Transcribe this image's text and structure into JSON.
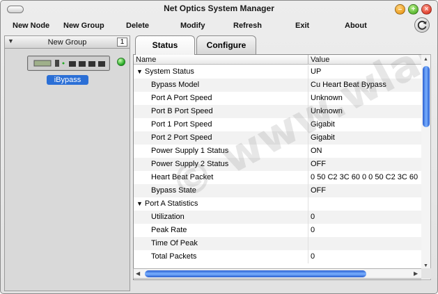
{
  "window": {
    "title": "Net Optics System Manager"
  },
  "menu": {
    "items": [
      "New Node",
      "New Group",
      "Delete",
      "Modify",
      "Refresh",
      "Exit",
      "About"
    ]
  },
  "icons": {
    "pill": "toolbar-toggle-icon",
    "minimize": "minimize-icon",
    "maximize": "maximize-icon",
    "close": "close-icon",
    "refresh": "refresh-icon",
    "device": "network-device-icon",
    "status": "status-ok-icon"
  },
  "sidebar": {
    "group_name": "New Group",
    "group_count": "1",
    "device_label": "iBypass"
  },
  "tabs": [
    "Status",
    "Configure"
  ],
  "table": {
    "headers": [
      "Name",
      "Value"
    ],
    "rows": [
      {
        "name": "System Status",
        "value": "UP",
        "section": true
      },
      {
        "name": "Bypass Model",
        "value": "Cu Heart Beat Bypass"
      },
      {
        "name": "Port A Port Speed",
        "value": "Unknown"
      },
      {
        "name": "Port B Port Speed",
        "value": "Unknown"
      },
      {
        "name": "Port 1 Port Speed",
        "value": "Gigabit"
      },
      {
        "name": "Port 2 Port Speed",
        "value": "Gigabit"
      },
      {
        "name": "Power Supply 1 Status",
        "value": "ON"
      },
      {
        "name": "Power Supply 2 Status",
        "value": "OFF"
      },
      {
        "name": "Heart Beat Packet",
        "value": "0 50 C2 3C 60 0 0 50 C2 3C 60"
      },
      {
        "name": "Bypass State",
        "value": "OFF"
      },
      {
        "name": "Port A Statistics",
        "value": "",
        "section": true
      },
      {
        "name": "Utilization",
        "value": "0"
      },
      {
        "name": "Peak Rate",
        "value": "0"
      },
      {
        "name": "Time Of Peak",
        "value": ""
      },
      {
        "name": "Total Packets",
        "value": "0"
      }
    ]
  },
  "watermark": "© www.wlab.net",
  "colors": {
    "accent": "#2b6fd6",
    "status_ok": "#1fa51f"
  }
}
